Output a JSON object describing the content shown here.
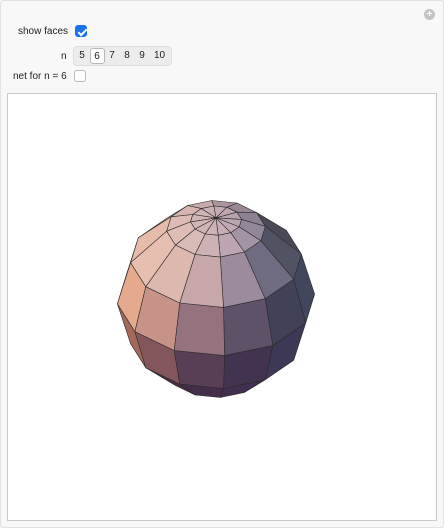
{
  "controls": {
    "show_faces_label": "show faces",
    "show_faces_checked": true,
    "n_label": "n",
    "n_options": [
      "5",
      "6",
      "7",
      "8",
      "9",
      "10"
    ],
    "n_selected": "6",
    "net_label": "net for n = 6",
    "net_checked": false
  },
  "colors": {
    "checkbox_accent": "#1a73e8",
    "panel_background": "#f8f8f8",
    "plot_background": "#ffffff"
  },
  "plot": {
    "object": "polyhedral sphere"
  }
}
